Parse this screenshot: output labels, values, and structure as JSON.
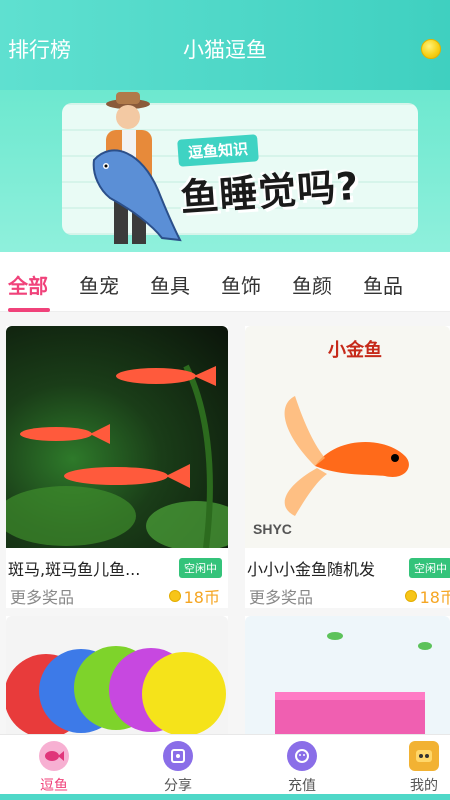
{
  "header": {
    "rank_label": "排行榜",
    "title": "小猫逗鱼",
    "coin_icon": "gold-coin-icon"
  },
  "banner": {
    "tag": "逗鱼知识",
    "headline": "鱼睡觉吗?"
  },
  "tabs": [
    {
      "label": "全部",
      "active": true
    },
    {
      "label": "鱼宠",
      "active": false
    },
    {
      "label": "鱼具",
      "active": false
    },
    {
      "label": "鱼饰",
      "active": false
    },
    {
      "label": "鱼颜",
      "active": false
    },
    {
      "label": "鱼品",
      "active": false
    }
  ],
  "products": [
    {
      "name": "斑马,斑马鱼儿鱼...",
      "status": "空闲中",
      "more": "更多奖品",
      "price": "18币"
    },
    {
      "name": "小小小金鱼随机发",
      "status": "空闲中",
      "more": "更多奖品",
      "price": "18币",
      "image_text": "小金鱼",
      "brand": "SHYC"
    },
    {
      "name": "",
      "status": "",
      "more": "",
      "price": ""
    },
    {
      "name": "",
      "status": "",
      "more": "",
      "price": ""
    }
  ],
  "bottom_nav": [
    {
      "label": "逗鱼",
      "icon": "fish-icon",
      "active": true
    },
    {
      "label": "分享",
      "icon": "share-icon",
      "active": false
    },
    {
      "label": "充值",
      "icon": "recharge-icon",
      "active": false
    },
    {
      "label": "我的",
      "icon": "robot-profile-icon",
      "active": false
    }
  ],
  "colors": {
    "accent": "#f0427a",
    "header": "#4fd8c8",
    "price": "#f5a623",
    "status": "#34c37a"
  }
}
